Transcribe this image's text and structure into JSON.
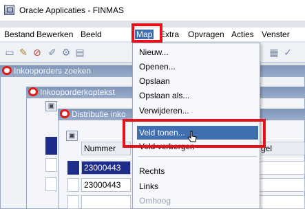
{
  "window": {
    "title": "Oracle Applicaties - FINMAS"
  },
  "menubar": [
    {
      "label": "Bestand"
    },
    {
      "label": "Bewerken"
    },
    {
      "label": "Beeld"
    },
    {
      "label": "Map"
    },
    {
      "label": "Extra"
    },
    {
      "label": "Opvragen"
    },
    {
      "label": "Acties"
    },
    {
      "label": "Venster"
    }
  ],
  "windows": {
    "inkoop_zoeken": {
      "title": "Inkooporders zoeken"
    },
    "koptekst": {
      "title": "Inkooporderkoptekst"
    },
    "distributie": {
      "title": "Distributie inko"
    }
  },
  "grid": {
    "header_left": "Nummer",
    "header_right": "gel",
    "rows": [
      "23000443",
      "23000443"
    ]
  },
  "map_menu": {
    "items": [
      {
        "label": "Nieuw..."
      },
      {
        "label": "Openen..."
      },
      {
        "label": "Opslaan"
      },
      {
        "label": "Opslaan als..."
      },
      {
        "label": "Verwijderen..."
      },
      {
        "label": "Veld tonen..."
      },
      {
        "label": "Veld verbergen"
      },
      {
        "label": "Rechts"
      },
      {
        "label": "Links"
      },
      {
        "label": "Omhoog"
      }
    ]
  },
  "colors": {
    "highlight": "#3f6fae",
    "annotation_red": "#e8111a",
    "window_titlebar": "#8ba0c2"
  }
}
